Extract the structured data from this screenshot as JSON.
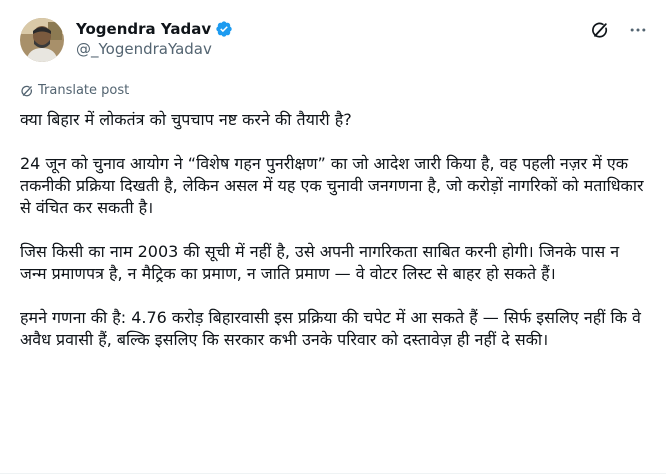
{
  "author": {
    "display_name": "Yogendra Yadav",
    "handle": "@_YogendraYadav",
    "verified": true
  },
  "actions": {
    "grok_icon": "grok-icon",
    "more_icon": "more-icon"
  },
  "translate": {
    "label": "Translate post"
  },
  "post": {
    "paragraphs": [
      "क्या बिहार में लोकतंत्र को चुपचाप नष्ट करने की तैयारी है?",
      "24 जून को चुनाव आयोग ने “विशेष गहन पुनरीक्षण” का जो आदेश जारी किया है, वह पहली नज़र में एक तकनीकी प्रक्रिया दिखती है, लेकिन असल में यह एक चुनावी जनगणना है, जो करोड़ों नागरिकों को मताधिकार से वंचित कर सकती है।",
      "जिस किसी का नाम 2003 की सूची में नहीं है, उसे अपनी नागरिकता साबित करनी होगी। जिनके पास न जन्म प्रमाणपत्र है, न मैट्रिक का प्रमाण, न जाति प्रमाण — वे वोटर लिस्ट से बाहर हो सकते हैं।",
      "हमने गणना की है: 4.76 करोड़ बिहारवासी इस प्रक्रिया की चपेट में आ सकते हैं — सिर्फ इसलिए नहीं कि वे अवैध प्रवासी हैं, बल्कि इसलिए कि सरकार कभी उनके परिवार को दस्तावेज़ ही नहीं दे सकी।"
    ]
  },
  "colors": {
    "text": "#0f1419",
    "secondary": "#536471",
    "verified_badge": "#1d9bf0"
  }
}
